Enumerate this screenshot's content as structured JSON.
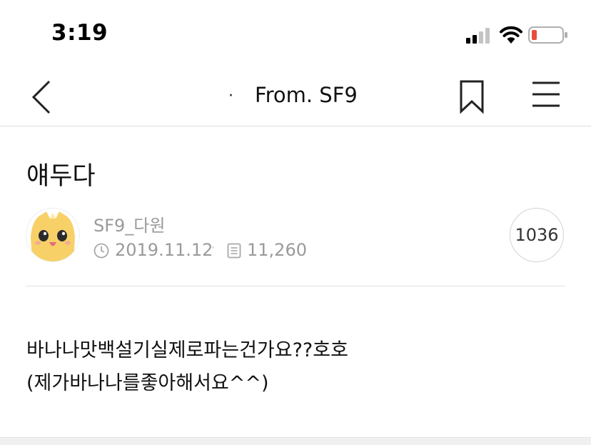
{
  "status_bar": {
    "time": "3:19",
    "battery_color": "#e94b3c"
  },
  "nav": {
    "title_prefix": "·",
    "title": "From. SF9",
    "icons": [
      "chevron-left-icon",
      "bookmark-icon",
      "hamburger-menu-icon"
    ]
  },
  "post": {
    "title": "얘두다",
    "author": "SF9_다원",
    "date": "2019.11.12",
    "separator": "·",
    "views": "11,260",
    "comment_count": "1036",
    "body_lines": [
      "바나나맛백설기실제로파는건가요??호호",
      "(제가바나나를좋아해서요^^)"
    ]
  },
  "colors": {
    "text_primary": "#111111",
    "text_meta": "#9a9a9a",
    "avatar_yellow": "#f7d067"
  }
}
